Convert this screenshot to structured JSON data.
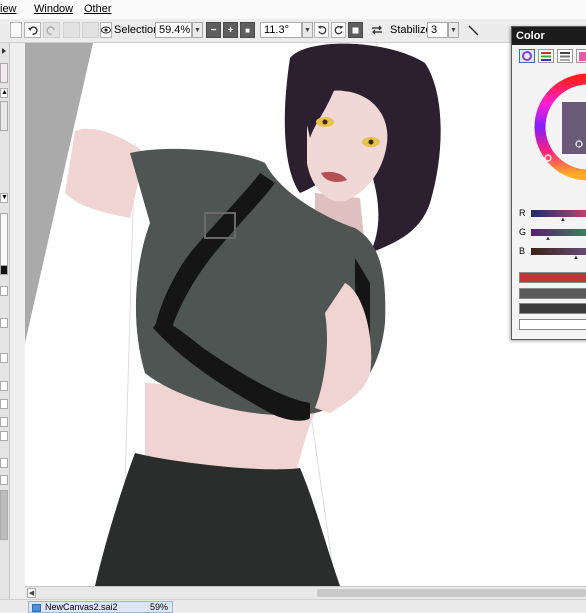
{
  "menu": {
    "view_label": "iew",
    "window_label": "Window",
    "other_label": "Other"
  },
  "toolbar": {
    "selection_label": "Selection",
    "zoom_value": "59.4%",
    "zoom_minus": "−",
    "zoom_plus": "+",
    "zoom_reset": "■",
    "rotation_value": "11.3°",
    "stabilizer_label": "Stabilizer",
    "stabilizer_value": "3"
  },
  "color_panel": {
    "title": "Color",
    "channels": [
      {
        "label": "R",
        "color": "#1d2b6e"
      },
      {
        "label": "G",
        "color": "#5a1d6e"
      },
      {
        "label": "B",
        "color": "#3a2418"
      }
    ],
    "swatches": [
      "#c8323a",
      "#5a5a5a",
      "#3c3c3c",
      "#ffffff"
    ]
  },
  "statusbar": {
    "document_name": "NewCanvas2.sai2",
    "document_zoom": "59%"
  },
  "icons": {
    "undo": "undo-icon",
    "redo": "redo-icon",
    "eye": "eye-icon",
    "rotate_ccw": "rotate-ccw-icon",
    "rotate_cw": "rotate-cw-icon",
    "rotate_reset": "rotate-reset-icon",
    "flip": "flip-horizontal-icon",
    "pen": "pen-icon"
  },
  "colors": {
    "canvas_bg": "#aaaaaa",
    "titlebar": "#1c1c1c",
    "accent": "#3a6fb8"
  }
}
